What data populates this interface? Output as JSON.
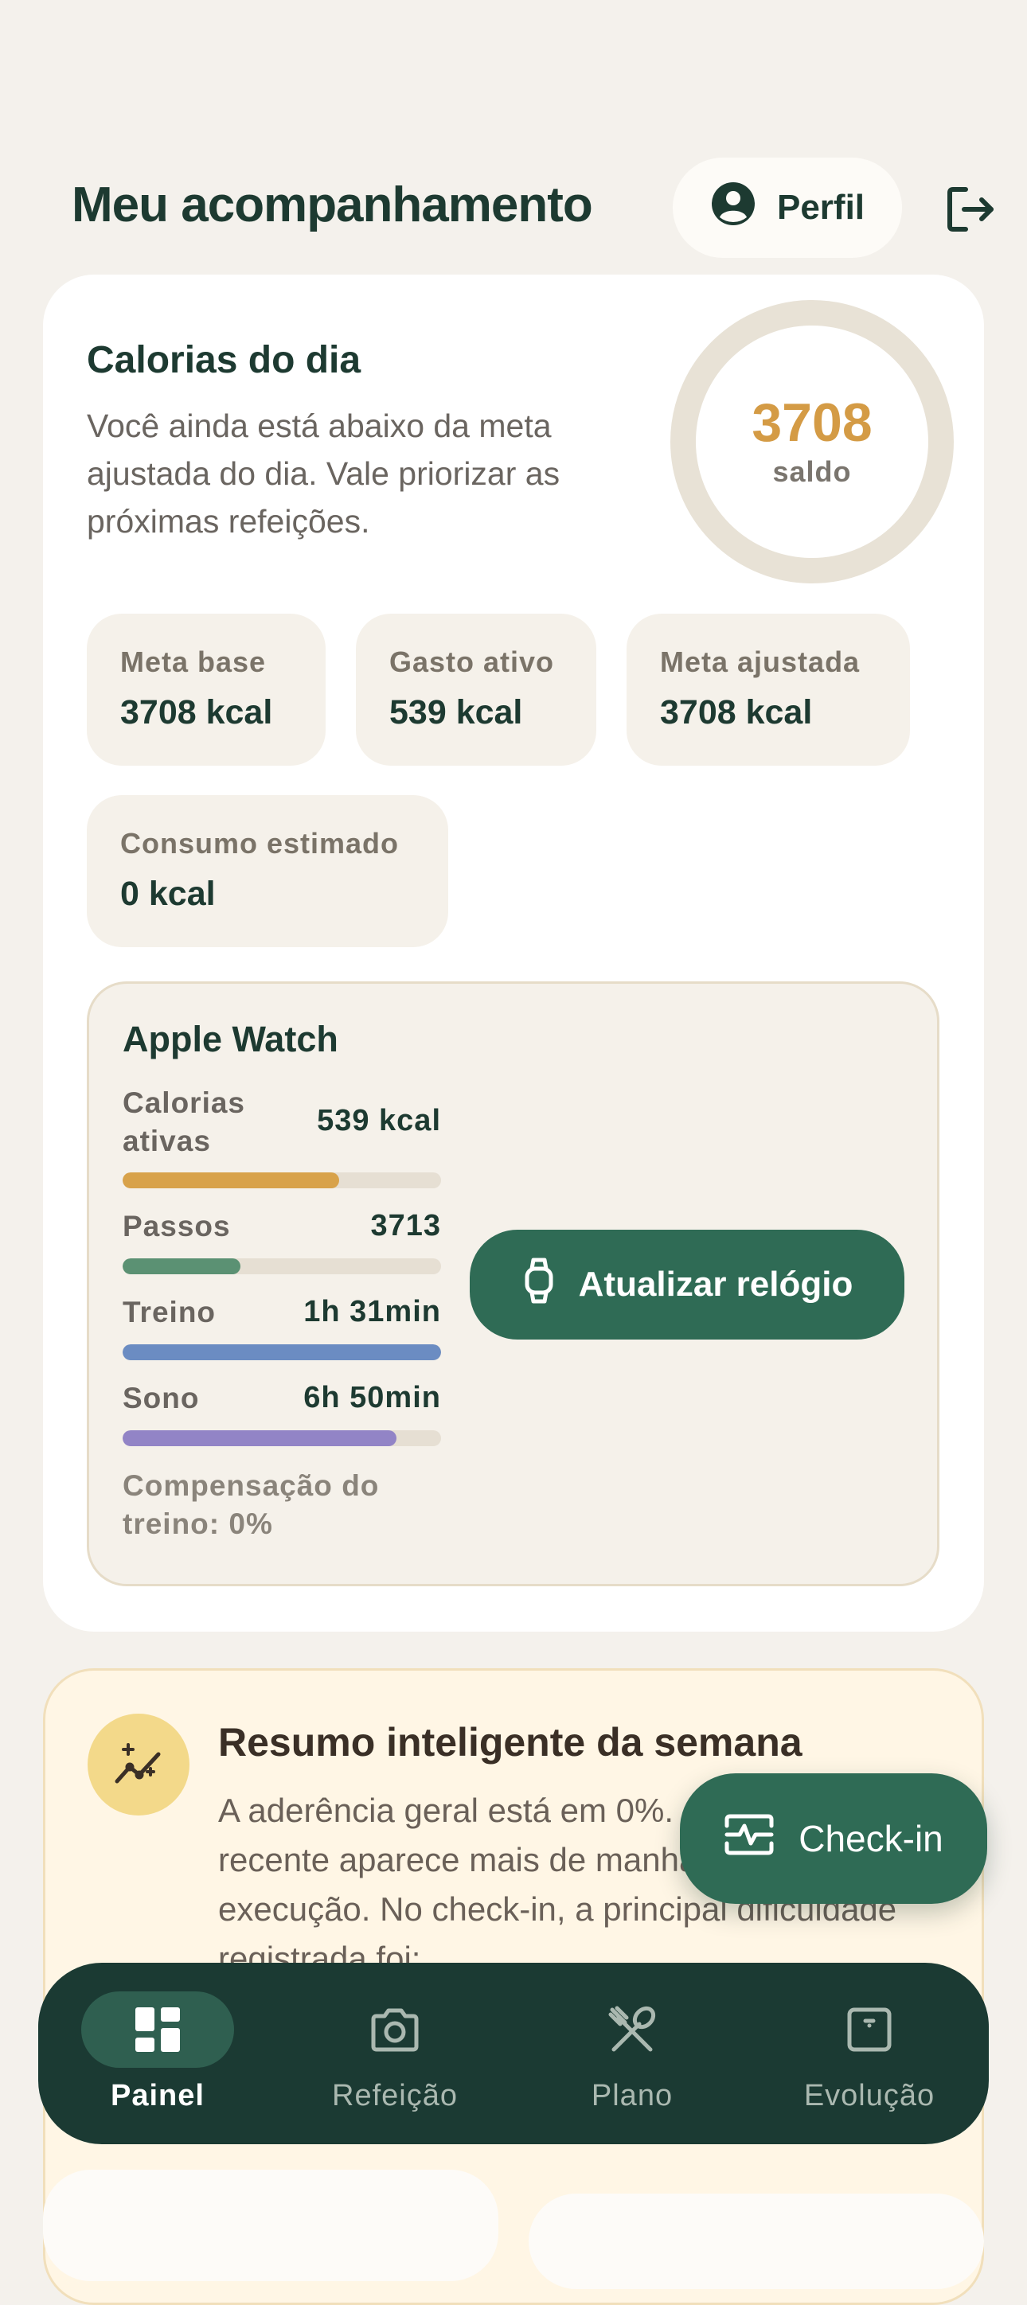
{
  "header": {
    "title": "Meu acompanhamento",
    "profile_label": "Perfil"
  },
  "calories": {
    "title": "Calorias do dia",
    "description": "Você ainda está abaixo da meta ajustada do dia. Vale priorizar as próximas refeições.",
    "balance_value": "3708",
    "balance_label": "saldo",
    "stats": [
      {
        "label": "Meta base",
        "value": "3708 kcal"
      },
      {
        "label": "Gasto ativo",
        "value": "539 kcal"
      },
      {
        "label": "Meta ajustada",
        "value": "3708 kcal"
      },
      {
        "label": "Consumo estimado",
        "value": "0 kcal"
      }
    ]
  },
  "watch": {
    "title": "Apple Watch",
    "metrics": [
      {
        "label": "Calorias ativas",
        "value": "539 kcal",
        "progress": 0.68,
        "color": "#d8a24a"
      },
      {
        "label": "Passos",
        "value": "3713",
        "progress": 0.37,
        "color": "#5b9173"
      },
      {
        "label": "Treino",
        "value": "1h 31min",
        "progress": 1.0,
        "color": "#6b8cc2"
      },
      {
        "label": "Sono",
        "value": "6h 50min",
        "progress": 0.86,
        "color": "#9284c6"
      }
    ],
    "compensation": "Compensação do treino: 0%",
    "update_button": "Atualizar relógio"
  },
  "summary": {
    "title": "Resumo inteligente da semana",
    "text": "A aderência geral está em 0%. A dificuldade recente aparece mais de manhã, com 0% de execução. No check-in, a principal dificuldade registrada foi:"
  },
  "checkin_label": "Check-in",
  "nav": {
    "items": [
      {
        "label": "Painel",
        "icon": "dashboard-icon",
        "active": true
      },
      {
        "label": "Refeição",
        "icon": "camera-icon",
        "active": false
      },
      {
        "label": "Plano",
        "icon": "utensils-icon",
        "active": false
      },
      {
        "label": "Evolução",
        "icon": "scale-icon",
        "active": false
      }
    ]
  },
  "colors": {
    "primary": "#2f6b55",
    "dark_nav": "#1b3a33",
    "accent": "#d49b45",
    "background": "#f4f1ec"
  }
}
